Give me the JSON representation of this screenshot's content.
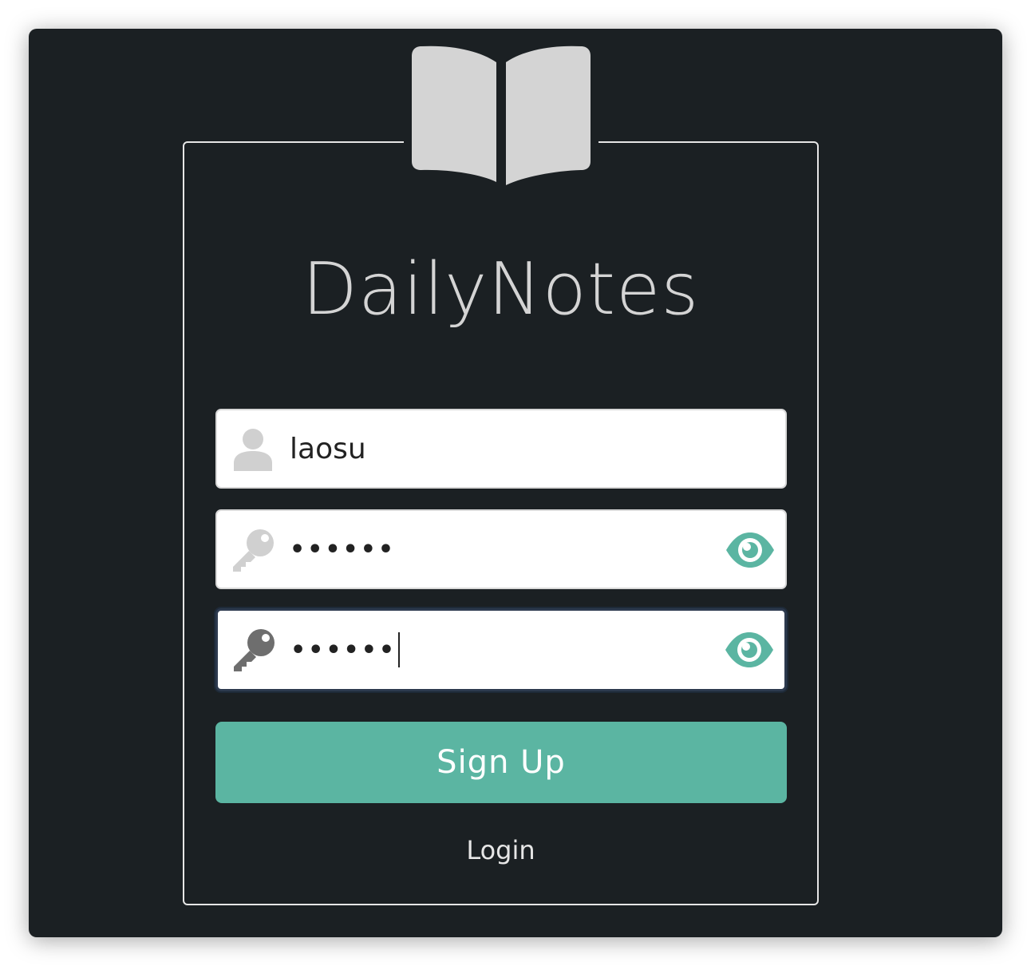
{
  "app": {
    "title": "DailyNotes"
  },
  "form": {
    "username": {
      "value": "laosu",
      "icon": "user-icon"
    },
    "password": {
      "value": "••••••",
      "icon": "key-icon",
      "toggle_icon": "eye-icon"
    },
    "confirm_password": {
      "value": "••••••",
      "icon": "key-icon",
      "toggle_icon": "eye-icon"
    }
  },
  "actions": {
    "signup_label": "Sign Up",
    "login_label": "Login"
  },
  "colors": {
    "background": "#1b2023",
    "accent": "#5bb5a2",
    "logo": "#d4d4d4"
  }
}
